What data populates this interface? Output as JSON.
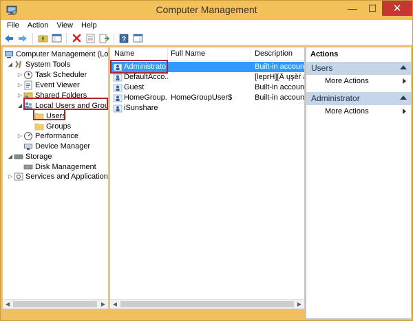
{
  "window": {
    "title": "Computer Management",
    "minimize": "—",
    "maximize": "☐",
    "close": "✕"
  },
  "menu": [
    "File",
    "Action",
    "View",
    "Help"
  ],
  "tree": {
    "root": "Computer Management (Local",
    "system_tools": "System Tools",
    "task_scheduler": "Task Scheduler",
    "event_viewer": "Event Viewer",
    "shared_folders": "Shared Folders",
    "local_users_groups": "Local Users and Groups",
    "users": "Users",
    "groups": "Groups",
    "performance": "Performance",
    "device_manager": "Device Manager",
    "storage": "Storage",
    "disk_management": "Disk Management",
    "services_apps": "Services and Applications"
  },
  "list": {
    "columns": [
      "Name",
      "Full Name",
      "Description"
    ],
    "rows": [
      {
        "name": "Administrator",
        "full_name": "",
        "description": "Built-in account"
      },
      {
        "name": "DefaultAcco...",
        "full_name": "",
        "description": "[leprH][Â ųşěŕ а"
      },
      {
        "name": "Guest",
        "full_name": "",
        "description": "Built-in account"
      },
      {
        "name": "HomeGroup...",
        "full_name": "HomeGroupUser$",
        "description": "Built-in account"
      },
      {
        "name": "iSunshare",
        "full_name": "",
        "description": ""
      }
    ]
  },
  "actions": {
    "title": "Actions",
    "sections": [
      {
        "name": "Users",
        "item": "More Actions"
      },
      {
        "name": "Administrator",
        "item": "More Actions"
      }
    ]
  },
  "colors": {
    "title_bar": "#f3c15a",
    "selection": "#3399ff",
    "highlight_box": "#b0232e",
    "section_header": "#c5d5e8"
  }
}
